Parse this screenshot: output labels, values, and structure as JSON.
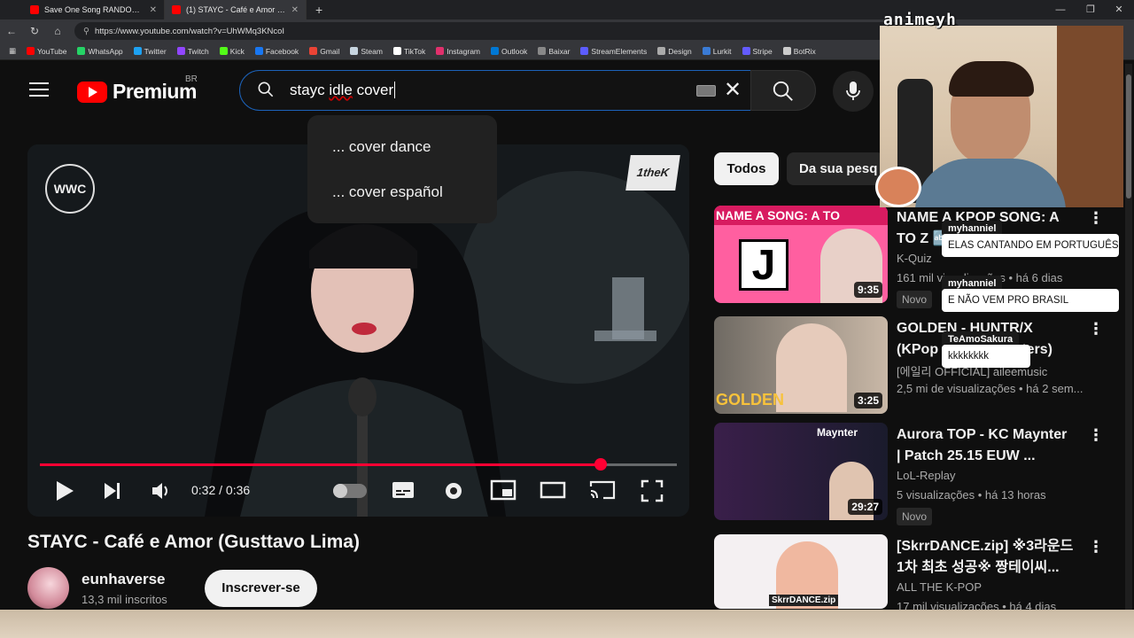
{
  "browser": {
    "tabs": [
      {
        "label": "Save One Song RANDOM Rules 🔥"
      },
      {
        "label": "(1) STAYC - Café e Amor (Gustta"
      }
    ],
    "url": "https://www.youtube.com/watch?v=UhWMq3KNcoI",
    "bookmarks": [
      {
        "label": "YouTube",
        "color": "#ff0000"
      },
      {
        "label": "WhatsApp",
        "color": "#25d366"
      },
      {
        "label": "Twitter",
        "color": "#1da1f2"
      },
      {
        "label": "Twitch",
        "color": "#9146ff"
      },
      {
        "label": "Kick",
        "color": "#53fc18"
      },
      {
        "label": "Facebook",
        "color": "#1877f2"
      },
      {
        "label": "Gmail",
        "color": "#ea4335"
      },
      {
        "label": "Steam",
        "color": "#c7d5e0"
      },
      {
        "label": "TikTok",
        "color": "#ffffff"
      },
      {
        "label": "Instagram",
        "color": "#e1306c"
      },
      {
        "label": "Outlook",
        "color": "#0078d4"
      },
      {
        "label": "Baixar",
        "color": "#888888"
      },
      {
        "label": "StreamElements",
        "color": "#5c5cff"
      },
      {
        "label": "Design",
        "color": "#aaaaaa"
      },
      {
        "label": "Lurkit",
        "color": "#3a7bd5"
      },
      {
        "label": "Stripe",
        "color": "#635bff"
      },
      {
        "label": "BotRix",
        "color": "#cccccc"
      }
    ]
  },
  "header": {
    "logo_text": "Premium",
    "region": "BR",
    "search_value_plain": "stayc ",
    "search_value_underlined": "idle",
    "search_value_rest": " cover"
  },
  "suggestions": [
    "... cover dance",
    "... cover español"
  ],
  "player": {
    "channel_logo": "WWC",
    "brand_logo": "1theK",
    "time": "0:32 / 0:36",
    "progress": 0.88
  },
  "video": {
    "title": "STAYC - Café e Amor (Gusttavo Lima)",
    "channel": "eunhaverse",
    "subscribers": "13,3 mil inscritos",
    "subscribe_label": "Inscrever-se"
  },
  "chips": {
    "all": "Todos",
    "yours": "Da sua pesq"
  },
  "recommendations": [
    {
      "title": "NAME A KPOP SONG: A TO Z 🔤 | ...",
      "channel": "K-Quiz",
      "meta": "161 mil visualizações • há 6 dias",
      "badge": "Novo",
      "duration": "9:35",
      "thumb_text": "NAME A SONG: A TO",
      "thumb_letter": "J"
    },
    {
      "title": "GOLDEN - HUNTR/X (KPop Demon Hunters) cover by...",
      "channel": "[에일리 OFFICIAL] aileemusic",
      "meta": "2,5 mi de visualizações • há 2 sem...",
      "badge": "",
      "duration": "3:25",
      "thumb_text": "GOLDEN",
      "thumb_letter": ""
    },
    {
      "title": "Aurora TOP - KC Maynter | Patch 25.15 EUW ...",
      "channel": "LoL-Replay",
      "meta": "5 visualizações • há 13 horas",
      "badge": "Novo",
      "duration": "29:27",
      "thumb_text": "Maynter",
      "thumb_letter": ""
    },
    {
      "title": "[SkrrDANCE.zip] ※3라운드 1차 최초 성공※ 짱테이씨...",
      "channel": "ALL THE K-POP",
      "meta": "17 mil visualizações • há 4 dias",
      "badge": "",
      "duration": "",
      "thumb_text": "SkrrDANCE.zip",
      "thumb_letter": ""
    }
  ],
  "webcam": {
    "label": "animeyh"
  },
  "chat": [
    {
      "user": "myhanniel",
      "message": "ELAS CANTANDO EM PORTUGUÊS"
    },
    {
      "user": "myhanniel",
      "message": "E NÃO VEM PRO BRASIL"
    },
    {
      "user": "TeAmoSakura",
      "message": "kkkkkkkk"
    }
  ],
  "colors": {
    "accent": "#ff0033",
    "search_border": "#1c62b9"
  }
}
